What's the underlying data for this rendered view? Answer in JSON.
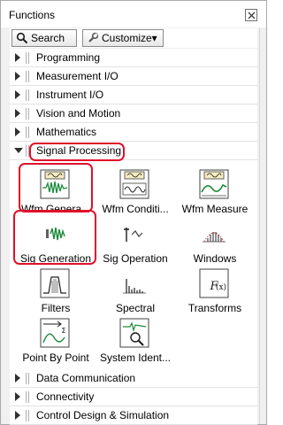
{
  "window": {
    "title": "Functions"
  },
  "toolbar": {
    "search_label": "Search",
    "customize_label": "Customize▾"
  },
  "categories_top": [
    {
      "label": "Programming"
    },
    {
      "label": "Measurement I/O"
    },
    {
      "label": "Instrument I/O"
    },
    {
      "label": "Vision and Motion"
    },
    {
      "label": "Mathematics"
    },
    {
      "label": "Signal Processing"
    }
  ],
  "signal_processing_items": [
    {
      "label": "Wfm Genera...",
      "icon": "waveform-generation-icon"
    },
    {
      "label": "Wfm Conditi...",
      "icon": "waveform-conditioning-icon"
    },
    {
      "label": "Wfm Measure",
      "icon": "waveform-measure-icon"
    },
    {
      "label": "Sig Generation",
      "icon": "signal-generation-icon"
    },
    {
      "label": "Sig Operation",
      "icon": "signal-operation-icon"
    },
    {
      "label": "Windows",
      "icon": "windows-icon"
    },
    {
      "label": "Filters",
      "icon": "filters-icon"
    },
    {
      "label": "Spectral",
      "icon": "spectral-icon"
    },
    {
      "label": "Transforms",
      "icon": "transforms-icon"
    },
    {
      "label": "Point By Point",
      "icon": "point-by-point-icon"
    },
    {
      "label": "System Ident...",
      "icon": "system-identification-icon"
    }
  ],
  "categories_bottom": [
    {
      "label": "Data Communication"
    },
    {
      "label": "Connectivity"
    },
    {
      "label": "Control Design & Simulation"
    }
  ],
  "colors": {
    "highlight": "#e0102a",
    "signal_green": "#1a8a3a",
    "panel_yellow": "#f4ecc0"
  }
}
